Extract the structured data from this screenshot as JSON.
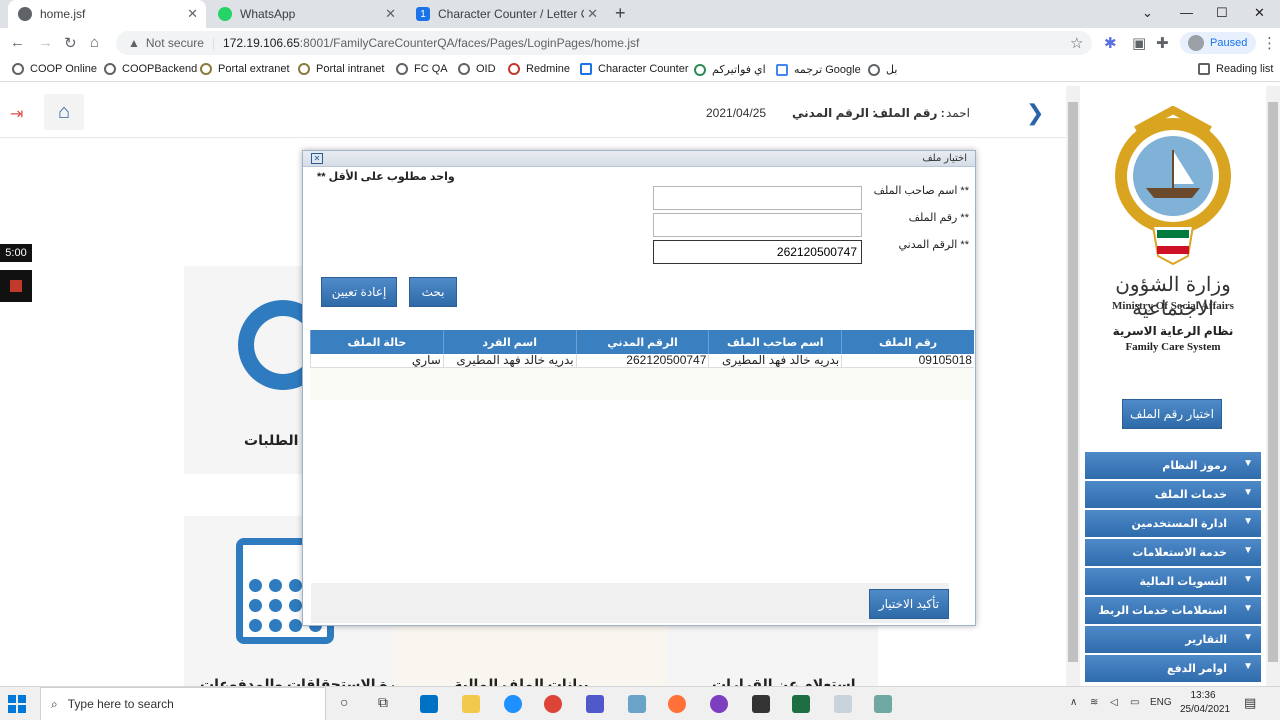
{
  "browser": {
    "tabs": [
      {
        "title": "home.jsf",
        "color": "#5f6368"
      },
      {
        "title": "WhatsApp",
        "color": "#25d366"
      },
      {
        "title": "Character Counter / Letter Count",
        "color": "#1a73e8"
      }
    ],
    "url": {
      "security": "Not secure",
      "host": "172.19.106.65",
      "path": ":8001/FamilyCareCounterQA/faces/Pages/LoginPages/home.jsf"
    },
    "profile_status": "Paused",
    "bookmarks": [
      "COOP Online",
      "COOPBackend",
      "Portal extranet",
      "Portal intranet",
      "FC QA",
      "OID",
      "Redmine",
      "Character Counter",
      "اي فواتيركم",
      "ترجمه Google",
      "بل"
    ],
    "reading_list": "Reading list"
  },
  "header": {
    "name": "احمد",
    "file_label": "رقم الملف :",
    "civil_label": "الرقم المدني :",
    "date": "2021/04/25"
  },
  "background": {
    "tile1_text": "ة الطلبات",
    "tile2_text": "ادارة الاستحقاقات والمدفوعات",
    "tile3_text": "بيانات الملف المالية",
    "tile4_text": "استعلام عن القرارات"
  },
  "overlay": {
    "timer": "5:00"
  },
  "dialog": {
    "title": "اختيار ملف",
    "requirement": "** واحد مطلوب على الأقل",
    "fields": {
      "owner_name": {
        "label": "** اسم صاحب الملف",
        "value": ""
      },
      "file_number": {
        "label": "** رقم الملف",
        "value": ""
      },
      "civil_id": {
        "label": "** الرقم المدني",
        "value": "262120500747"
      }
    },
    "search_button": "بحث",
    "reset_button": "إعادة تعيين",
    "table": {
      "headers": [
        "رقم الملف",
        "اسم صاحب الملف",
        "الرقم المدني",
        "اسم الفرد",
        "حالة الملف"
      ],
      "rows": [
        [
          "09105018",
          "بدريه خالد فهد المطيرى",
          "262120500747",
          "بدريه خالد فهد المطيرى",
          "ساري"
        ]
      ]
    },
    "confirm_button": "تأكيد الاختيار"
  },
  "sidebar": {
    "ministry_ar": "وزارة الشؤون الاجتماعية",
    "ministry_en": "Ministry Of Social Affairs",
    "system_ar": "نظام الرعاية الاسرية",
    "system_en": "Family Care System",
    "pick_file_button": "اختيار رقم الملف",
    "menu": [
      "رموز النظام",
      "خدمات الملف",
      "ادارة المستخدمين",
      "خدمة الاستعلامات",
      "التسويات المالية",
      "استعلامات خدمات الربط",
      "التقارير",
      "اوامر الدفع"
    ]
  },
  "taskbar": {
    "search_placeholder": "Type here to search",
    "lang": "ENG",
    "time": "13:36",
    "date": "25/04/2021"
  }
}
